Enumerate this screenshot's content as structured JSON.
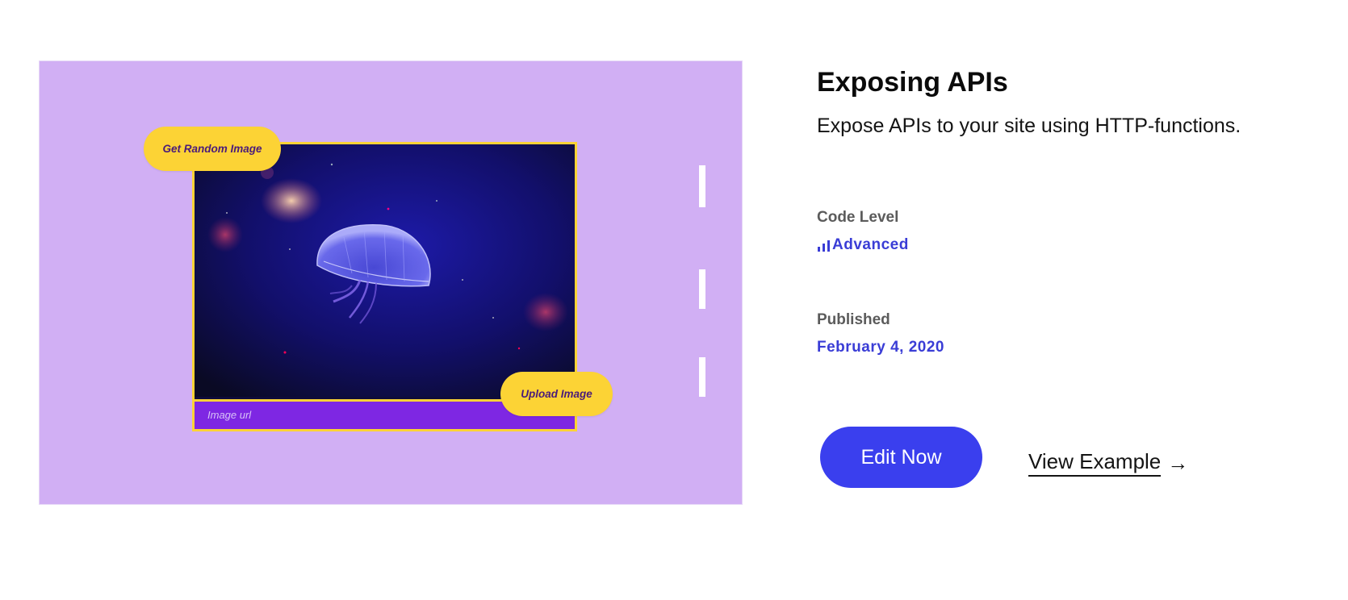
{
  "preview": {
    "random_button_label": "Get Random Image",
    "upload_button_label": "Upload Image",
    "url_placeholder": "Image url",
    "photo_subject": "jellyfish"
  },
  "info": {
    "title": "Exposing APIs",
    "description": "Expose APIs to your site using HTTP-functions.",
    "code_level_label": "Code Level",
    "code_level_value": "Advanced",
    "published_label": "Published",
    "published_value": "February 4, 2020"
  },
  "actions": {
    "edit_label": "Edit Now",
    "view_label": "View Example",
    "view_arrow": "→"
  },
  "colors": {
    "preview_bg": "#d1aff4",
    "accent_yellow": "#fcd335",
    "accent_purple": "#7e27e3",
    "link_blue": "#3a3dd6",
    "button_blue": "#3a3fee"
  }
}
